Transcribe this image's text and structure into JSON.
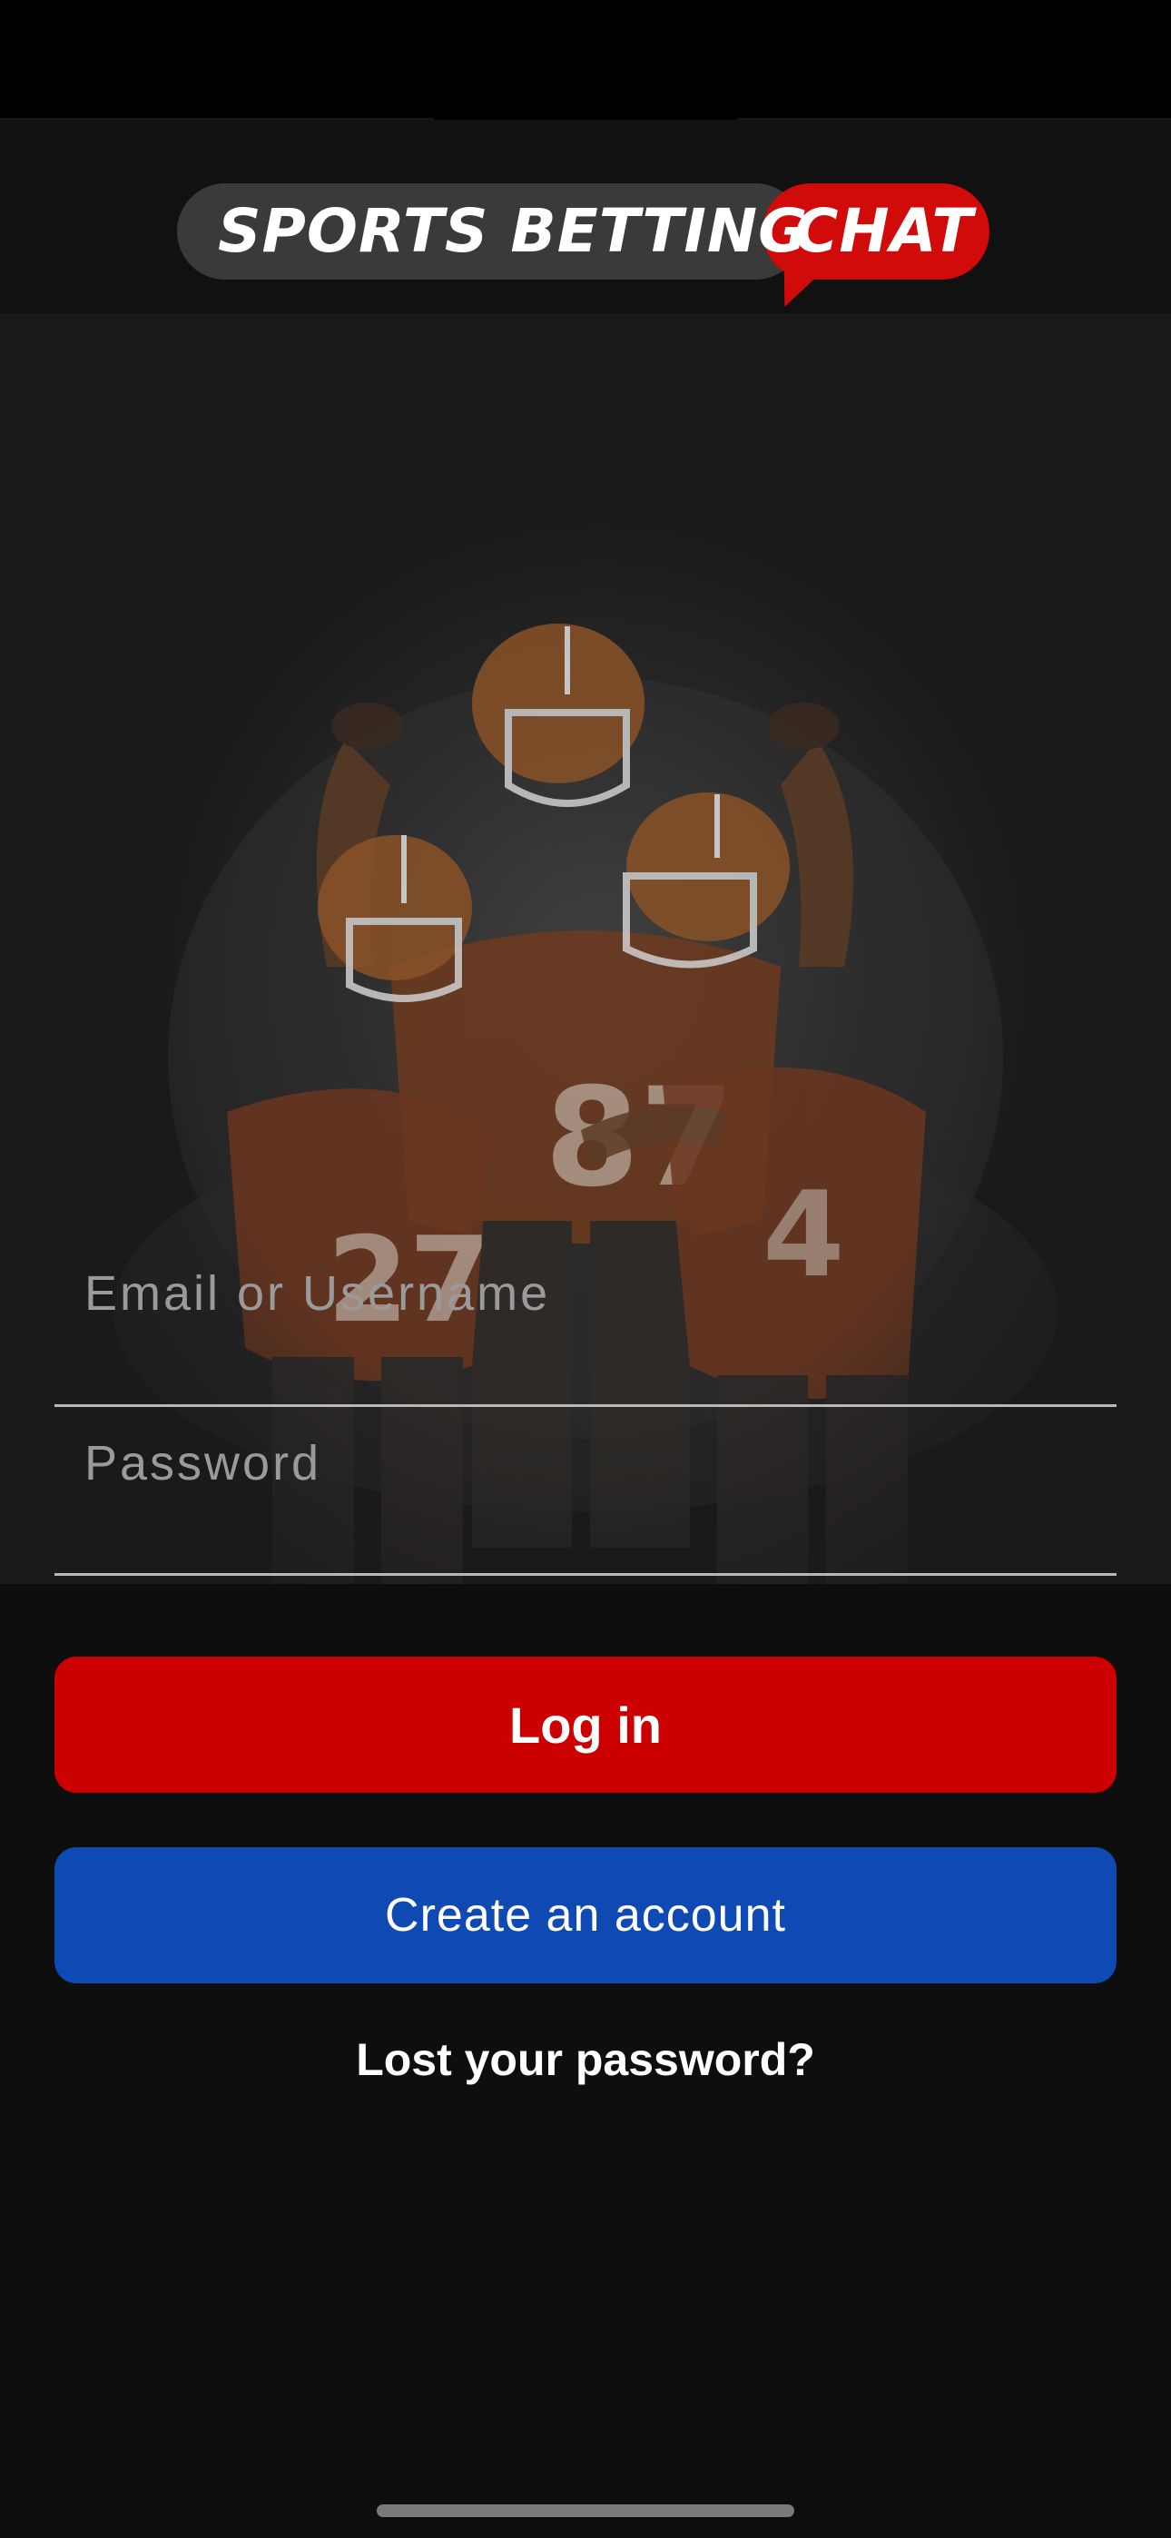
{
  "header": {
    "logo_left_text": "SPORTS BETTING",
    "logo_right_text": "CHAT"
  },
  "hero": {
    "image": "football-players-celebrating",
    "jersey_numbers": [
      "87",
      "27",
      "4"
    ]
  },
  "form": {
    "email_placeholder": "Email or Username",
    "email_value": "",
    "password_placeholder": "Password",
    "password_value": ""
  },
  "actions": {
    "login_label": "Log in",
    "create_account_label": "Create an account",
    "lost_password_label": "Lost your password?"
  },
  "colors": {
    "background": "#0e0e0e",
    "hero_background": "#1a1a1a",
    "brand_red": "#cc0000",
    "create_blue": "#0f4ab4"
  }
}
